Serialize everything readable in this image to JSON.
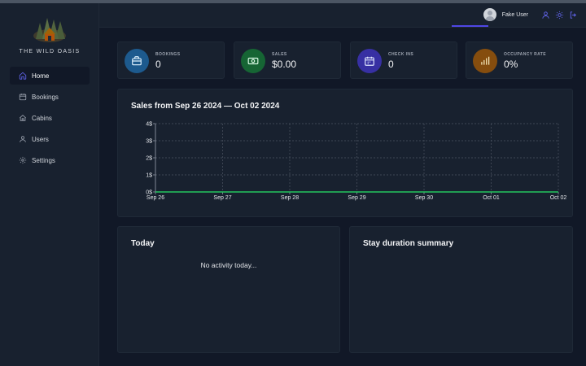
{
  "brand": {
    "name": "THE WILD OASIS"
  },
  "sidebar": {
    "items": [
      {
        "label": "Home",
        "icon": "home-icon",
        "active": true
      },
      {
        "label": "Bookings",
        "icon": "calendar-icon",
        "active": false
      },
      {
        "label": "Cabins",
        "icon": "cabin-icon",
        "active": false
      },
      {
        "label": "Users",
        "icon": "user-icon",
        "active": false
      },
      {
        "label": "Settings",
        "icon": "gear-icon",
        "active": false
      }
    ]
  },
  "header": {
    "username": "Fake User",
    "icons": [
      "account-icon",
      "sun-icon",
      "logout-icon"
    ]
  },
  "stats": [
    {
      "label": "BOOKINGS",
      "value": "0",
      "icon": "briefcase-icon",
      "color": "#1d5a8e"
    },
    {
      "label": "SALES",
      "value": "$0.00",
      "icon": "banknotes-icon",
      "color": "#166534"
    },
    {
      "label": "CHECK INS",
      "value": "0",
      "icon": "calendar-days-icon",
      "color": "#3730a3"
    },
    {
      "label": "OCCUPANCY RATE",
      "value": "0%",
      "icon": "chart-bar-icon",
      "color": "#854d0e"
    }
  ],
  "sales_panel": {
    "title": "Sales from Sep 26 2024 — Oct 02 2024"
  },
  "today_panel": {
    "title": "Today",
    "empty_text": "No activity today..."
  },
  "stay_panel": {
    "title": "Stay duration summary"
  },
  "chart_data": {
    "type": "area",
    "categories": [
      "Sep 26",
      "Sep 27",
      "Sep 28",
      "Sep 29",
      "Sep 30",
      "Oct 01",
      "Oct 02"
    ],
    "series": [
      {
        "values": [
          0,
          0,
          0,
          0,
          0,
          0,
          0
        ],
        "color": "#22c55e"
      }
    ],
    "y_ticks": [
      "0$",
      "1$",
      "2$",
      "3$",
      "4$"
    ],
    "ylim": [
      0,
      4
    ],
    "grid": true
  },
  "colors": {
    "accent": "#4f46e5",
    "background": "#111827",
    "panel": "#18212f"
  }
}
